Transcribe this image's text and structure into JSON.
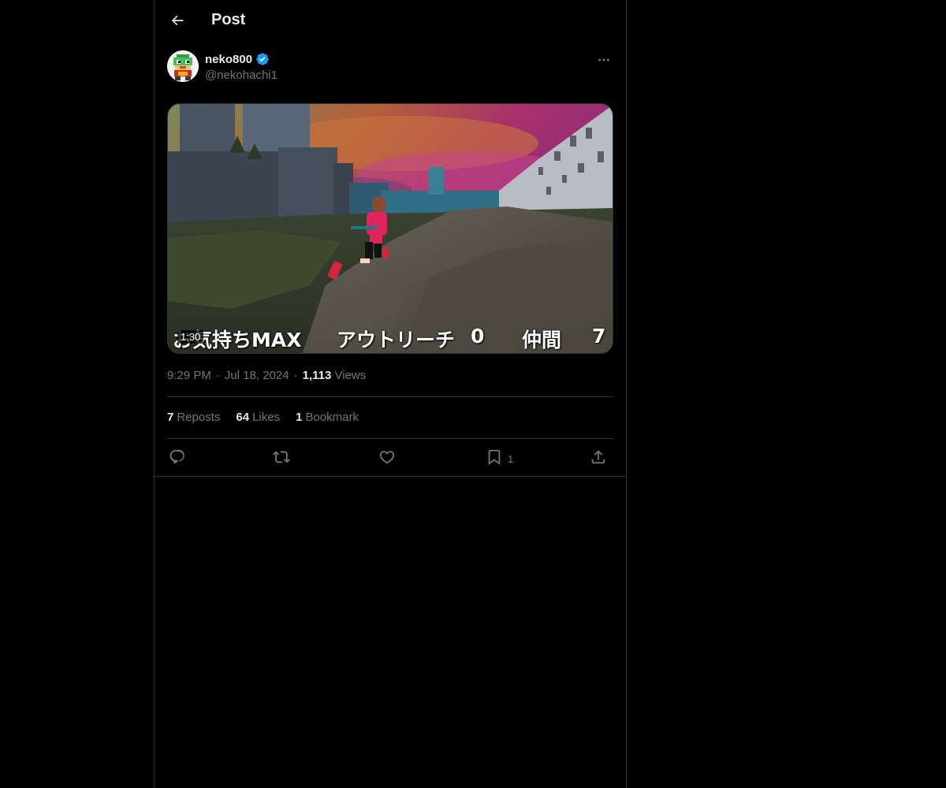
{
  "header": {
    "title": "Post"
  },
  "author": {
    "display_name": "neko800",
    "handle": "@nekohachi1",
    "verified": true
  },
  "media": {
    "duration": "1:30",
    "overlay": {
      "mood": "お気持ちMAX",
      "outreach_label": "アウトリーチ",
      "outreach_value": "0",
      "friends_label": "仲間",
      "friends_value": "7"
    }
  },
  "meta": {
    "time": "9:29 PM",
    "date": "Jul 18, 2024",
    "views_count": "1,113",
    "views_label": "Views"
  },
  "stats": {
    "reposts_count": "7",
    "reposts_label": "Reposts",
    "likes_count": "64",
    "likes_label": "Likes",
    "bookmarks_count": "1",
    "bookmarks_label": "Bookmark"
  },
  "actions": {
    "bookmark_count": "1"
  },
  "colors": {
    "background": "#000000",
    "border": "#2f3336",
    "text_primary": "#e7e9ea",
    "text_secondary": "#71767b",
    "verified_badge": "#1d9bf0"
  }
}
